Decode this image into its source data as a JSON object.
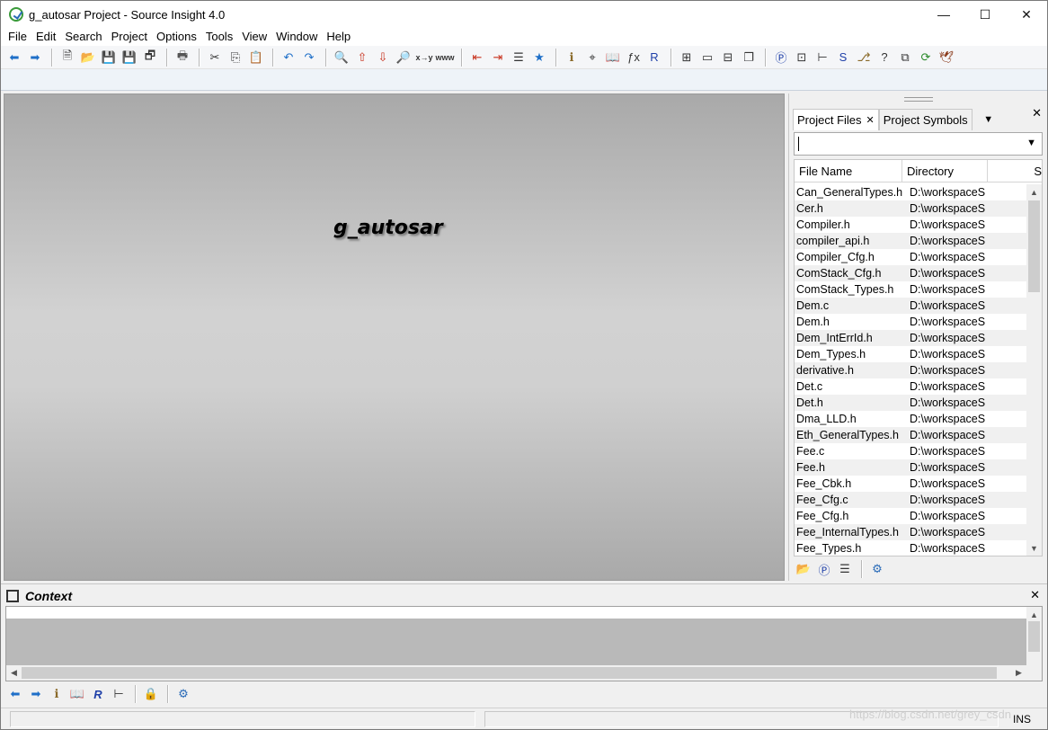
{
  "window": {
    "title": "g_autosar Project - Source Insight 4.0",
    "controls": {
      "minimize": "—",
      "maximize": "☐",
      "close": "✕"
    }
  },
  "menu": [
    "File",
    "Edit",
    "Search",
    "Project",
    "Options",
    "Tools",
    "View",
    "Window",
    "Help"
  ],
  "toolbar": {
    "groups": [
      [
        {
          "name": "back-button",
          "glyph": "⬅",
          "color": "#1e6fc8"
        },
        {
          "name": "forward-button",
          "glyph": "➡",
          "color": "#1e6fc8"
        }
      ],
      [
        {
          "name": "new-file-button",
          "glyph": "🗎",
          "color": "#333"
        },
        {
          "name": "open-file-button",
          "glyph": "📂",
          "color": "#c9a032"
        },
        {
          "name": "save-button",
          "glyph": "💾",
          "color": "#333"
        },
        {
          "name": "save-all-button",
          "glyph": "💾",
          "color": "#a00"
        },
        {
          "name": "close-file-button",
          "glyph": "🗗",
          "color": "#333"
        }
      ],
      [
        {
          "name": "print-button",
          "glyph": "🖶",
          "color": "#555"
        }
      ],
      [
        {
          "name": "cut-button",
          "glyph": "✂",
          "color": "#333"
        },
        {
          "name": "copy-button",
          "glyph": "⎘",
          "color": "#333"
        },
        {
          "name": "paste-button",
          "glyph": "📋",
          "color": "#8a6a2a"
        }
      ],
      [
        {
          "name": "undo-button",
          "glyph": "↶",
          "color": "#1e6fc8"
        },
        {
          "name": "redo-button",
          "glyph": "↷",
          "color": "#1e6fc8"
        }
      ],
      [
        {
          "name": "find-button",
          "glyph": "🔍",
          "color": "#333"
        },
        {
          "name": "search-backward-button",
          "glyph": "⇧",
          "color": "#c8321e"
        },
        {
          "name": "search-forward-button",
          "glyph": "⇩",
          "color": "#c8321e"
        },
        {
          "name": "search-files-button",
          "glyph": "🔎",
          "color": "#333"
        },
        {
          "name": "replace-button",
          "glyph": "x→y",
          "color": "#333"
        },
        {
          "name": "search-web-button",
          "glyph": "www",
          "color": "#333"
        }
      ],
      [
        {
          "name": "bookmark-prev-button",
          "glyph": "⇤",
          "color": "#c8321e"
        },
        {
          "name": "bookmark-next-button",
          "glyph": "⇥",
          "color": "#c8321e"
        },
        {
          "name": "bookmark-list-button",
          "glyph": "☰",
          "color": "#333"
        },
        {
          "name": "bookmark-toggle-button",
          "glyph": "★",
          "color": "#1e6fc8"
        }
      ],
      [
        {
          "name": "symbol-info-button",
          "glyph": "ℹ",
          "color": "#8a6a2a"
        },
        {
          "name": "jump-to-def-button",
          "glyph": "⌖",
          "color": "#333"
        },
        {
          "name": "lookup-ref-button",
          "glyph": "📖",
          "color": "#8a6a2a"
        },
        {
          "name": "function-button",
          "glyph": "ƒx",
          "color": "#333"
        },
        {
          "name": "relation-button",
          "glyph": "R",
          "color": "#1e3fa8"
        }
      ],
      [
        {
          "name": "layout-1-button",
          "glyph": "⊞",
          "color": "#333"
        },
        {
          "name": "layout-2-button",
          "glyph": "▭",
          "color": "#333"
        },
        {
          "name": "layout-3-button",
          "glyph": "⊟",
          "color": "#333"
        },
        {
          "name": "layout-4-button",
          "glyph": "❐",
          "color": "#333"
        }
      ],
      [
        {
          "name": "project-window-button",
          "glyph": "Ⓟ",
          "color": "#1e3fa8"
        },
        {
          "name": "context-window-button",
          "glyph": "⊡",
          "color": "#333"
        },
        {
          "name": "relation-window-button",
          "glyph": "⊢",
          "color": "#333"
        },
        {
          "name": "symbol-window-button",
          "glyph": "S",
          "color": "#1e3fa8"
        },
        {
          "name": "clip-window-button",
          "glyph": "⎇",
          "color": "#8a6a2a"
        },
        {
          "name": "help-window-button",
          "glyph": "?",
          "color": "#333"
        },
        {
          "name": "overview-button",
          "glyph": "⧉",
          "color": "#333"
        },
        {
          "name": "sync-button",
          "glyph": "⟳",
          "color": "#2a8a2a"
        },
        {
          "name": "bird-button",
          "glyph": "🕊",
          "color": "#8a3a1a"
        }
      ]
    ]
  },
  "editor": {
    "project_name": "g_autosar"
  },
  "project_panel": {
    "tabs": [
      {
        "label": "Project Files",
        "active": true,
        "closable": true
      },
      {
        "label": "Project Symbols",
        "active": false,
        "closable": false
      }
    ],
    "filter": {
      "value": ""
    },
    "columns": [
      "File Name",
      "Directory",
      "S"
    ],
    "files": [
      {
        "name": "Can_GeneralTypes.h",
        "dir": "D:\\workspaceS"
      },
      {
        "name": "Cer.h",
        "dir": "D:\\workspaceS"
      },
      {
        "name": "Compiler.h",
        "dir": "D:\\workspaceS"
      },
      {
        "name": "compiler_api.h",
        "dir": "D:\\workspaceS"
      },
      {
        "name": "Compiler_Cfg.h",
        "dir": "D:\\workspaceS"
      },
      {
        "name": "ComStack_Cfg.h",
        "dir": "D:\\workspaceS"
      },
      {
        "name": "ComStack_Types.h",
        "dir": "D:\\workspaceS"
      },
      {
        "name": "Dem.c",
        "dir": "D:\\workspaceS"
      },
      {
        "name": "Dem.h",
        "dir": "D:\\workspaceS"
      },
      {
        "name": "Dem_IntErrId.h",
        "dir": "D:\\workspaceS"
      },
      {
        "name": "Dem_Types.h",
        "dir": "D:\\workspaceS"
      },
      {
        "name": "derivative.h",
        "dir": "D:\\workspaceS"
      },
      {
        "name": "Det.c",
        "dir": "D:\\workspaceS"
      },
      {
        "name": "Det.h",
        "dir": "D:\\workspaceS"
      },
      {
        "name": "Dma_LLD.h",
        "dir": "D:\\workspaceS"
      },
      {
        "name": "Eth_GeneralTypes.h",
        "dir": "D:\\workspaceS"
      },
      {
        "name": "Fee.c",
        "dir": "D:\\workspaceS"
      },
      {
        "name": "Fee.h",
        "dir": "D:\\workspaceS"
      },
      {
        "name": "Fee_Cbk.h",
        "dir": "D:\\workspaceS"
      },
      {
        "name": "Fee_Cfg.c",
        "dir": "D:\\workspaceS"
      },
      {
        "name": "Fee_Cfg.h",
        "dir": "D:\\workspaceS"
      },
      {
        "name": "Fee_InternalTypes.h",
        "dir": "D:\\workspaceS"
      },
      {
        "name": "Fee_Types.h",
        "dir": "D:\\workspaceS"
      }
    ],
    "bottom_icons": [
      {
        "name": "open-folder-icon",
        "glyph": "📂",
        "color": "#1e6fc8"
      },
      {
        "name": "project-sync-icon",
        "glyph": "Ⓟ",
        "color": "#1e3fa8"
      },
      {
        "name": "file-list-icon",
        "glyph": "☰",
        "color": "#333"
      },
      {
        "name": "panel-settings-icon",
        "glyph": "⚙",
        "color": "#2a6bb8"
      }
    ]
  },
  "context_panel": {
    "title": "Context",
    "icons": [
      {
        "name": "ctx-back-icon",
        "glyph": "⬅",
        "color": "#1e6fc8"
      },
      {
        "name": "ctx-forward-icon",
        "glyph": "➡",
        "color": "#1e6fc8"
      },
      {
        "name": "ctx-symbol-info-icon",
        "glyph": "ℹ",
        "color": "#8a6a2a"
      },
      {
        "name": "ctx-lookup-icon",
        "glyph": "📖",
        "color": "#8a6a2a"
      },
      {
        "name": "ctx-relation-icon",
        "glyph": "R",
        "color": "#1e3fa8"
      },
      {
        "name": "ctx-tree-icon",
        "glyph": "⊢",
        "color": "#333"
      },
      {
        "name": "ctx-lock-icon",
        "glyph": "🔒",
        "color": "#555"
      },
      {
        "name": "ctx-settings-icon",
        "glyph": "⚙",
        "color": "#2a6bb8"
      }
    ]
  },
  "statusbar": {
    "mode": "INS",
    "watermark": "https://blog.csdn.net/grey_csdn"
  }
}
